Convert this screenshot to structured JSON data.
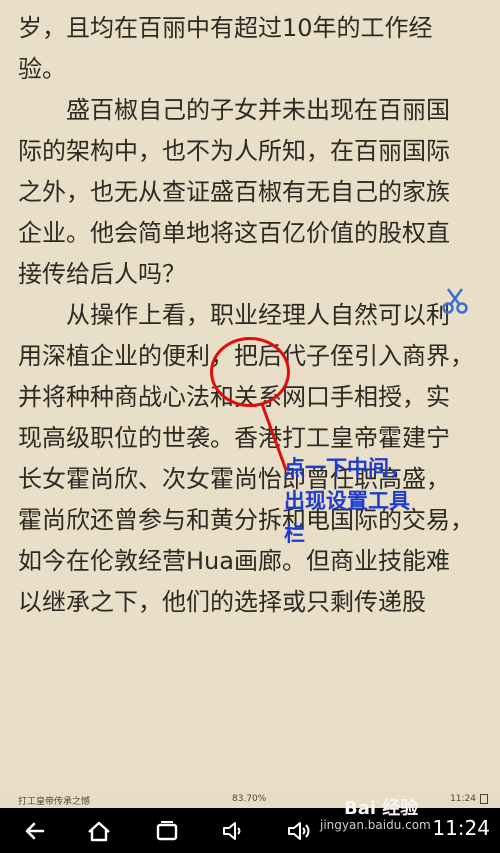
{
  "article": {
    "paragraphs": [
      {
        "indent": false,
        "lines": [
          "岁，且均在百丽中有超过10年的工作经",
          "验。"
        ]
      },
      {
        "indent": true,
        "lines": [
          "盛百椒自己的子女并未出现在百丽国",
          "际的架构中，也不为人所知，在百丽国际",
          "之外，也无从查证盛百椒有无自己的家族",
          "企业。他会简单地将这百亿价值的股权直",
          "接传给后人吗？"
        ]
      },
      {
        "indent": true,
        "lines": [
          "从操作上看，职业经理人自然可以利",
          "用深植企业的便利，把后代子侄引入商界，",
          "并将种种商战心法和关系网口手相授，实",
          "现高级职位的世袭。香港打工皇帝霍建宁",
          "长女霍尚欣、次女霍尚怡即曾任职高盛，",
          "霍尚欣还曾参与和黄分拆和电国际的交易，",
          "如今在伦敦经营Hua画廊。但商业技能难",
          "以继承之下，他们的选择或只剩传递股"
        ]
      }
    ]
  },
  "annotation": {
    "lines": [
      "点一下中间，",
      "出现设置工具",
      "栏"
    ],
    "color": "#1d3ad1",
    "circle_color": "#e10c0c"
  },
  "footer": {
    "book_title": "打工皇帝传承之憾",
    "progress_text": "83.70%",
    "time": "11:24"
  },
  "watermark": {
    "logo_text": "Bai 经验",
    "url": "jingyan.baidu.com"
  },
  "navbar": {
    "clock": "11:24",
    "buttons": [
      {
        "name": "back-button",
        "icon": "back-arrow-icon"
      },
      {
        "name": "home-button",
        "icon": "home-icon"
      },
      {
        "name": "recent-apps-button",
        "icon": "recent-apps-icon"
      },
      {
        "name": "volume-down-button",
        "icon": "volume-down-icon"
      },
      {
        "name": "volume-up-button",
        "icon": "volume-up-icon"
      }
    ]
  }
}
